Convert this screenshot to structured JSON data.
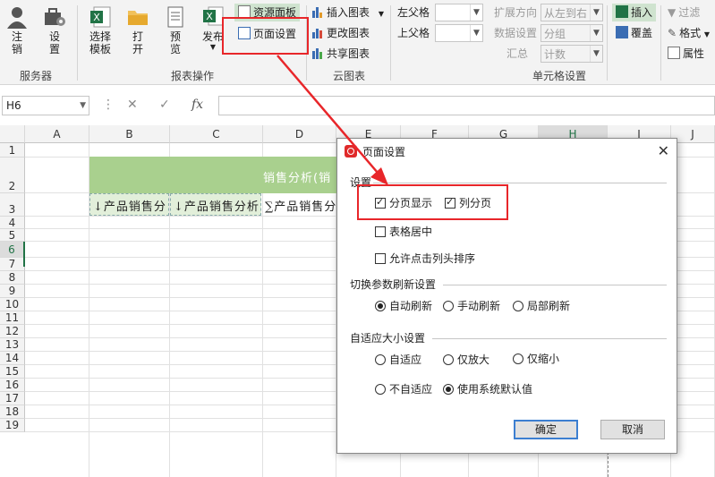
{
  "ribbon": {
    "server_group": {
      "label": "服务器",
      "logout": "注\n销",
      "settings": "设\n置"
    },
    "report_group": {
      "label": "报表操作",
      "choose_template": "选择\n模板",
      "open": "打\n开",
      "preview": "预\n览",
      "publish": "发布",
      "resource_panel": "资源面板",
      "page_setup": "页面设置"
    },
    "cloud_group": {
      "label": "云图表",
      "insert_chart": "插入图表",
      "change_chart": "更改图表",
      "share_chart": "共享图表"
    },
    "cell_group": {
      "label": "单元格设置",
      "left_parent": "左父格",
      "top_parent": "上父格",
      "expand_direction": "扩展方向",
      "expand_value": "从左到右",
      "data_setting": "数据设置",
      "data_value": "分组",
      "summary": "汇总",
      "summary_value": "计数"
    },
    "insert_group": {
      "insert": "插入",
      "cover": "覆盖"
    },
    "filter_group": {
      "filter": "过滤",
      "format": "格式",
      "property": "属性"
    }
  },
  "formula_bar": {
    "name_box": "H6",
    "fx": "fx"
  },
  "grid": {
    "columns": [
      "A",
      "B",
      "C",
      "D",
      "E",
      "F",
      "G",
      "H",
      "I",
      "J"
    ],
    "rows": [
      "1",
      "2",
      "3",
      "4",
      "5",
      "6",
      "7",
      "8",
      "9",
      "10",
      "11",
      "12",
      "13",
      "14",
      "15",
      "16",
      "17",
      "18",
      "19"
    ],
    "selected_col": "H",
    "selected_row": "6",
    "title_cell": "销售分析(销",
    "b3": "↓产品销售分",
    "c3": "↓产品销售分析",
    "d3": "∑产品销售分"
  },
  "dialog": {
    "title": "页面设置",
    "section_settings": "设置",
    "page_display": "分页显示",
    "page_display_checked": true,
    "column_page": "列分页",
    "column_page_checked": true,
    "table_center": "表格居中",
    "table_center_checked": false,
    "allow_sort": "允许点击列头排序",
    "allow_sort_checked": false,
    "section_refresh": "切换参数刷新设置",
    "auto_refresh": "自动刷新",
    "manual_refresh": "手动刷新",
    "partial_refresh": "局部刷新",
    "refresh_selected": "auto",
    "section_adapt": "自适应大小设置",
    "adapt": "自适应",
    "zoom_in_only": "仅放大",
    "zoom_out_only": "仅缩小",
    "no_adapt": "不自适应",
    "system_default": "使用系统默认值",
    "adapt_selected": "system_default",
    "ok": "确定",
    "cancel": "取消"
  },
  "colors": {
    "accent_green": "#217346",
    "header_fill": "#a9d08e",
    "annotation_red": "#e8262a"
  }
}
